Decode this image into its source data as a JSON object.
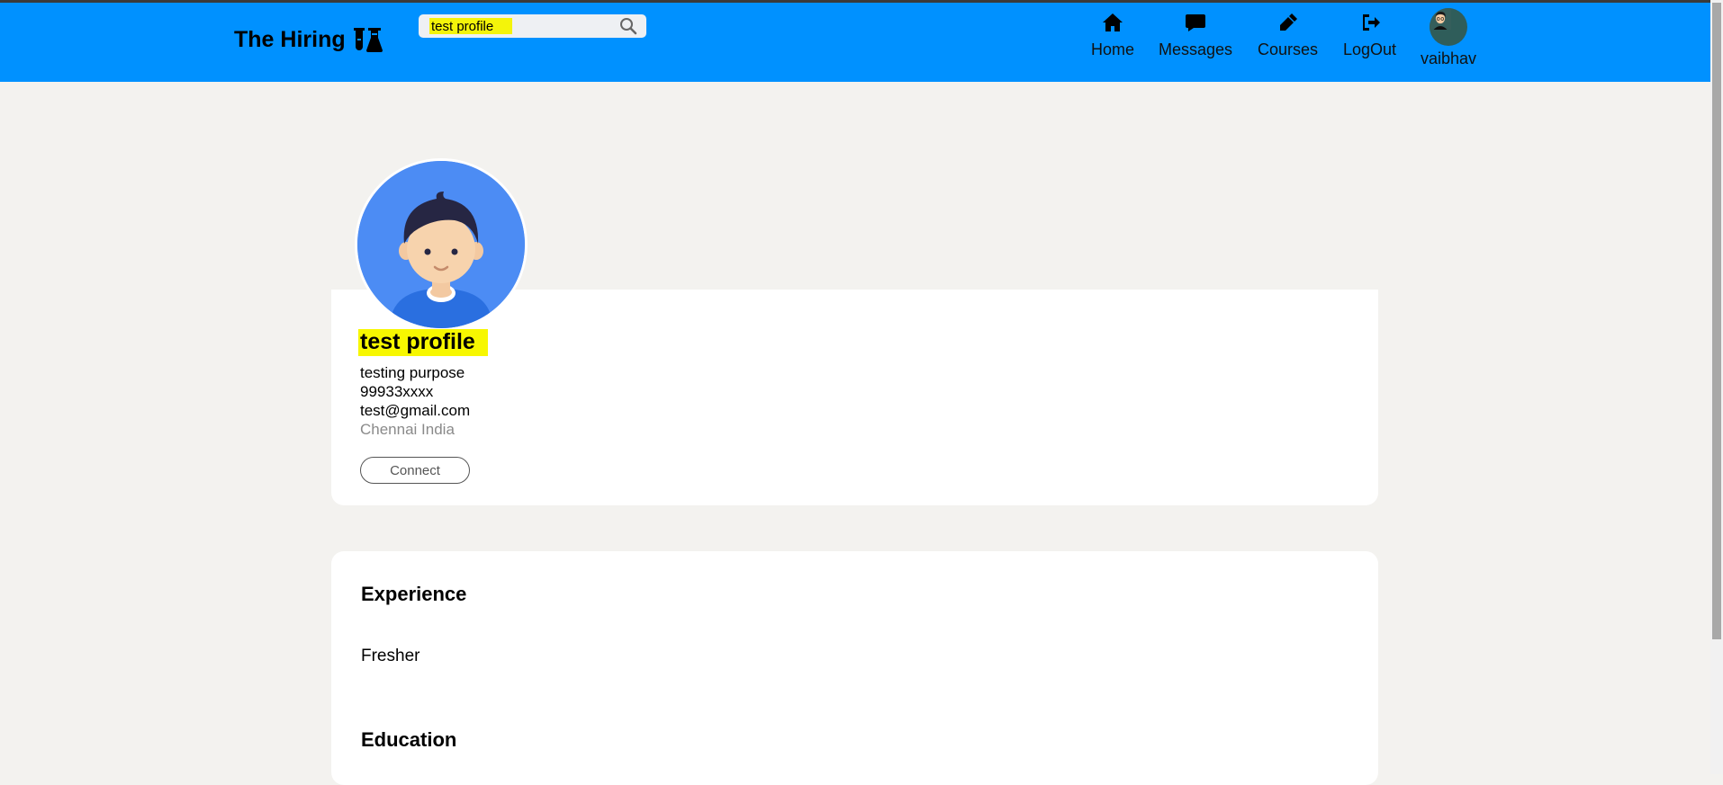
{
  "brand": {
    "name": "The Hiring",
    "icon": "flask-icon"
  },
  "search": {
    "value": "test profile",
    "placeholder": ""
  },
  "nav": {
    "home": "Home",
    "messages": "Messages",
    "courses": "Courses",
    "logout": "LogOut",
    "user": "vaibhav"
  },
  "profile": {
    "name": "test profile",
    "headline": "testing purpose",
    "phone": "99933xxxx",
    "email": "test@gmail.com",
    "location": "Chennai India",
    "connect_label": "Connect"
  },
  "experience": {
    "title": "Experience",
    "text": "Fresher"
  },
  "education": {
    "title": "Education"
  },
  "colors": {
    "navbar": "#0091ff",
    "highlight": "#f7f700",
    "background": "#f3f2ef"
  }
}
